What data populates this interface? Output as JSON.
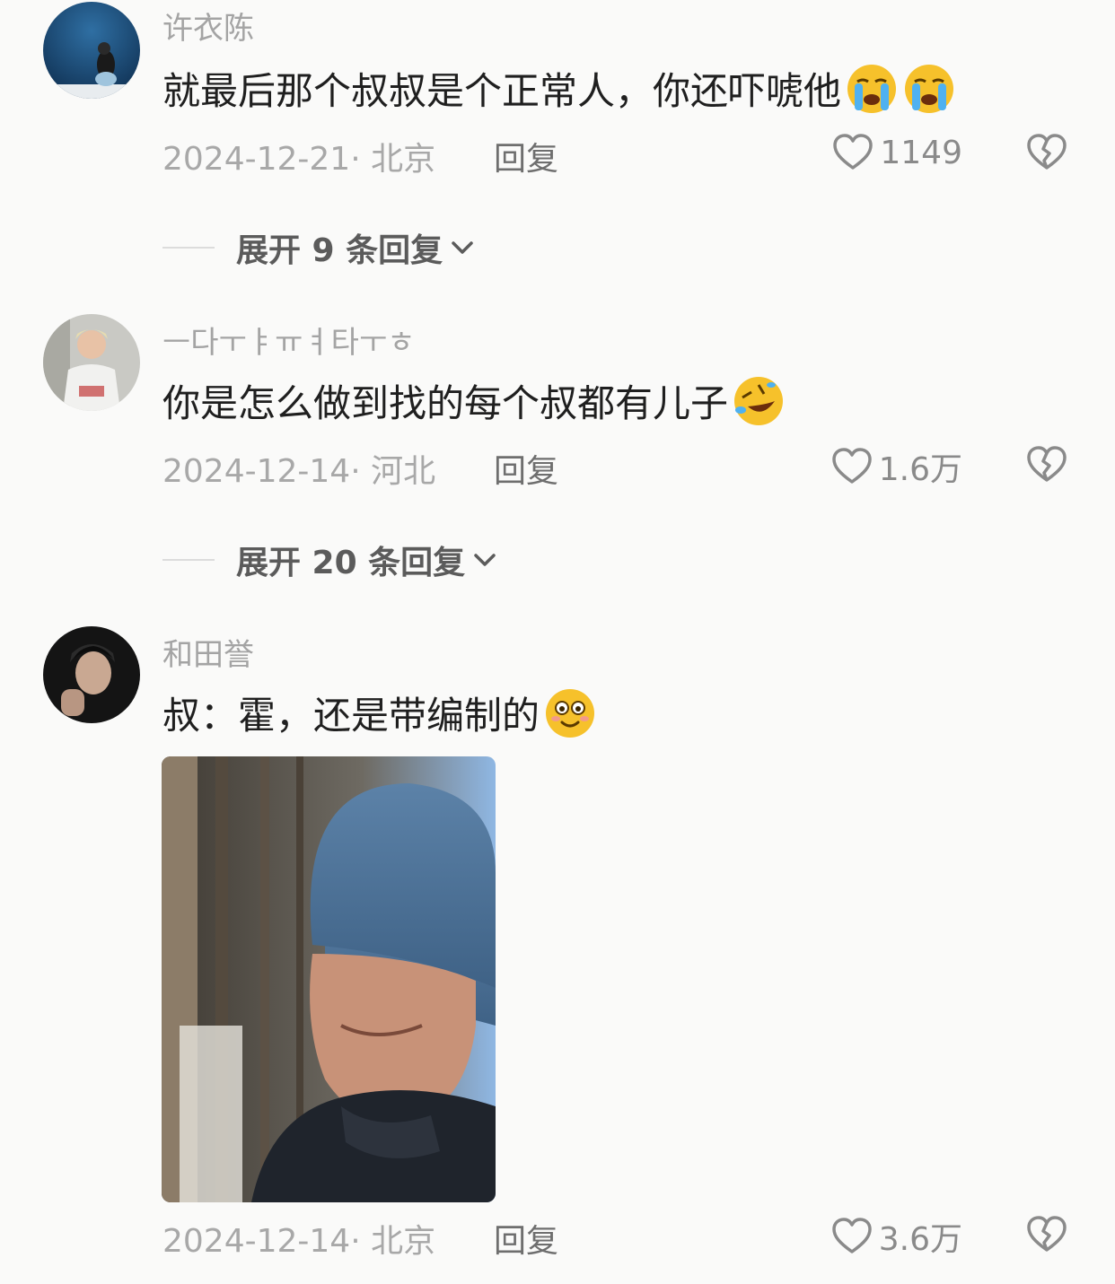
{
  "comments": [
    {
      "username": "许衣陈",
      "text": "就最后那个叔叔是个正常人，你还吓唬他",
      "emojis": [
        "crying-face",
        "crying-face"
      ],
      "date_location": "2024-12-21· 北京",
      "reply_label": "回复",
      "likes": "1149",
      "expand_label": "展开 9 条回复"
    },
    {
      "username": "ㅡ다ㅜㅑㅠㅕ타ㅜㅎ",
      "text": "你是怎么做到找的每个叔都有儿子",
      "emojis": [
        "rolling-laughing-face"
      ],
      "date_location": "2024-12-14· 河北",
      "reply_label": "回复",
      "likes": "1.6万",
      "expand_label": "展开 20 条回复"
    },
    {
      "username": "和田誉",
      "text": "叔：霍，还是带编制的",
      "emojis": [
        "smiling-face"
      ],
      "date_location": "2024-12-14· 北京",
      "reply_label": "回复",
      "likes": "3.6万"
    }
  ],
  "icons": {
    "like": "heart-outline-icon",
    "dislike": "broken-heart-icon",
    "expand": "chevron-down-icon"
  },
  "colors": {
    "background": "#fafaf9",
    "text": "#1f1f1f",
    "muted": "#a8a8a8",
    "emoji": "#f6c12b"
  }
}
